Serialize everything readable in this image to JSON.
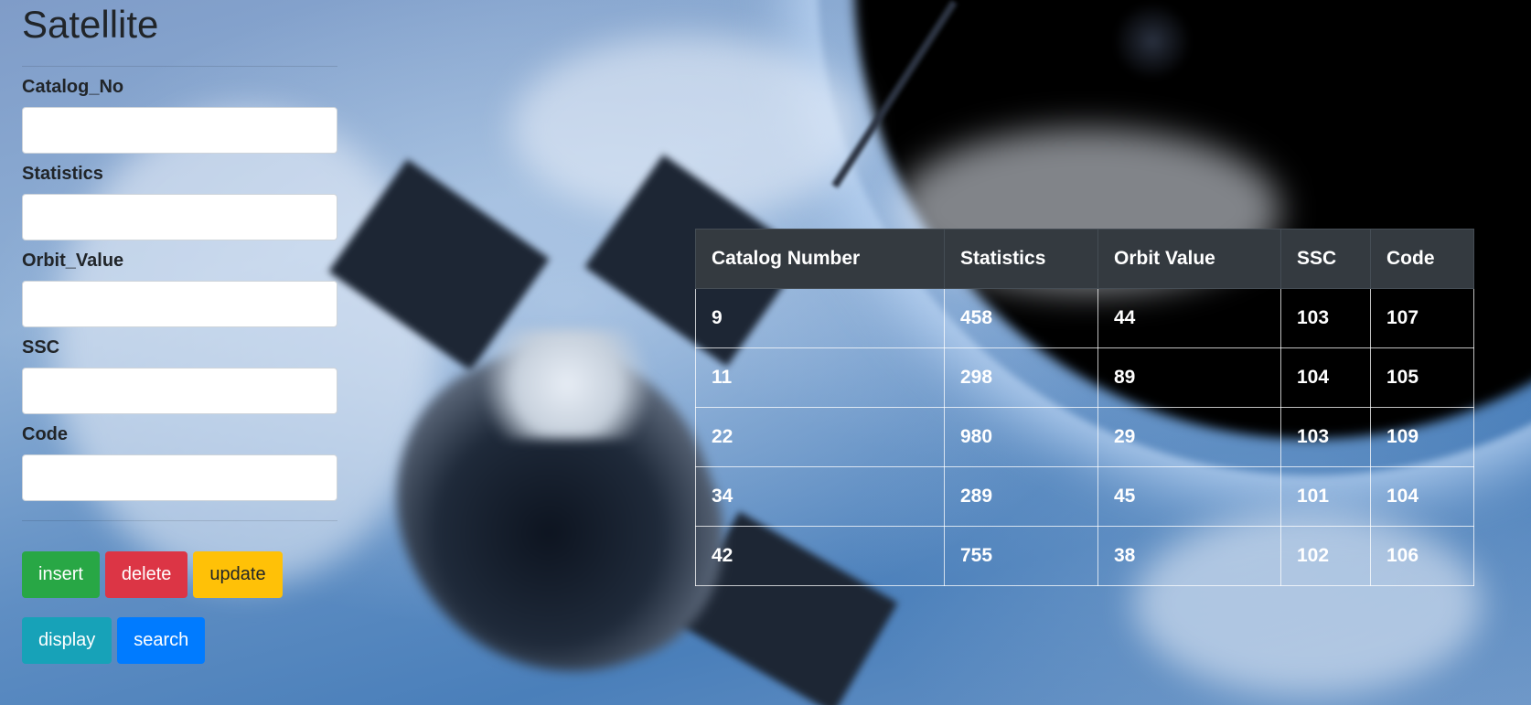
{
  "page": {
    "title": "Satellite"
  },
  "form": {
    "fields": [
      {
        "label": "Catalog_No",
        "value": "",
        "placeholder": ""
      },
      {
        "label": "Statistics",
        "value": "",
        "placeholder": ""
      },
      {
        "label": "Orbit_Value",
        "value": "",
        "placeholder": ""
      },
      {
        "label": "SSC",
        "value": "",
        "placeholder": ""
      },
      {
        "label": "Code",
        "value": "",
        "placeholder": ""
      }
    ]
  },
  "buttons": {
    "insert": "insert",
    "delete": "delete",
    "update": "update",
    "display": "display",
    "search": "search"
  },
  "colors": {
    "insert": "#28a745",
    "delete": "#dc3545",
    "update": "#ffc107",
    "display": "#17a2b8",
    "search": "#007bff",
    "table_header": "#343a40"
  },
  "table": {
    "headers": [
      "Catalog Number",
      "Statistics",
      "Orbit Value",
      "SSC",
      "Code"
    ],
    "rows": [
      [
        "9",
        "458",
        "44",
        "103",
        "107"
      ],
      [
        "11",
        "298",
        "89",
        "104",
        "105"
      ],
      [
        "22",
        "980",
        "29",
        "103",
        "109"
      ],
      [
        "34",
        "289",
        "45",
        "101",
        "104"
      ],
      [
        "42",
        "755",
        "38",
        "102",
        "106"
      ]
    ]
  }
}
